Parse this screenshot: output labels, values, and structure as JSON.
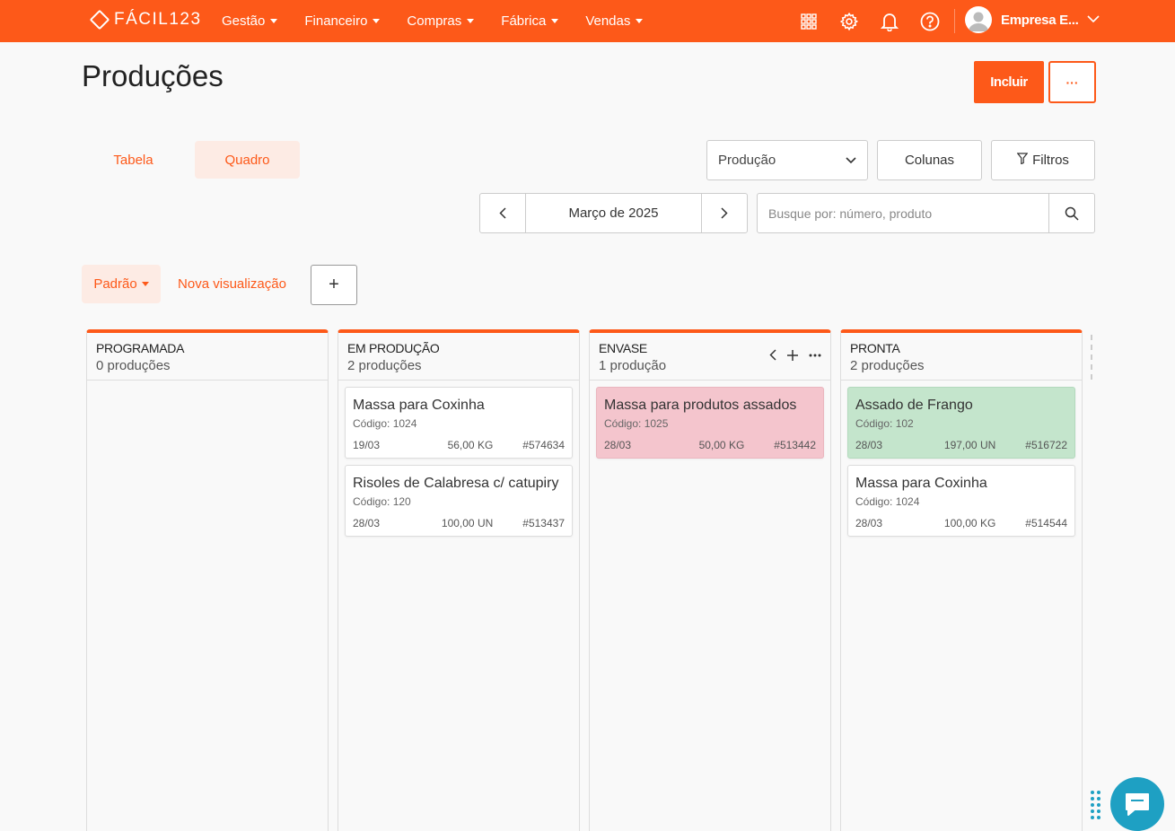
{
  "brand": {
    "name": "FÁCIL123",
    "color": "#fd5919"
  },
  "nav": {
    "menu": [
      {
        "label": "Gestão"
      },
      {
        "label": "Financeiro"
      },
      {
        "label": "Compras"
      },
      {
        "label": "Fábrica"
      },
      {
        "label": "Vendas"
      }
    ],
    "icons": [
      "apps-grid-icon",
      "gear-icon",
      "bell-icon",
      "help-icon"
    ],
    "profile_name": "Empresa E..."
  },
  "page": {
    "title": "Produções",
    "include_label": "Incluir",
    "more_label": "···"
  },
  "tabs": {
    "tabela": "Tabela",
    "quadro": "Quadro",
    "active": "Quadro"
  },
  "filters": {
    "group_select": "Produção",
    "columns_label": "Colunas",
    "filters_label": "Filtros",
    "month": "Março de 2025",
    "search_placeholder": "Busque por: número, produto"
  },
  "views": {
    "default_label": "Padrão",
    "new_label": "Nova visualização",
    "add_label": "+"
  },
  "board": {
    "columns": [
      {
        "title": "PROGRAMADA",
        "count": "0 produções",
        "cards": []
      },
      {
        "title": "EM PRODUÇÃO",
        "count": "2 produções",
        "cards": [
          {
            "title": "Massa para Coxinha",
            "code": "Código: 1024",
            "date": "19/03",
            "qty": "56,00 KG",
            "num": "#574634"
          },
          {
            "title": "Risoles de Calabresa c/ catupiry",
            "code": "Código: 120",
            "date": "28/03",
            "qty": "100,00 UN",
            "num": "#513437"
          }
        ]
      },
      {
        "title": "ENVASE",
        "count": "1 produção",
        "cards": [
          {
            "title": "Massa para produtos assados",
            "code": "Código: 1025",
            "date": "28/03",
            "qty": "50,00 KG",
            "num": "#513442",
            "color": "#f4c5cd"
          }
        ]
      },
      {
        "title": "PRONTA",
        "count": "2 produções",
        "cards": [
          {
            "title": "Assado de Frango",
            "code": "Código: 102",
            "date": "28/03",
            "qty": "197,00 UN",
            "num": "#516722",
            "color": "#c4e5cc"
          },
          {
            "title": "Massa para Coxinha",
            "code": "Código: 1024",
            "date": "28/03",
            "qty": "100,00 KG",
            "num": "#514544"
          }
        ]
      }
    ]
  }
}
